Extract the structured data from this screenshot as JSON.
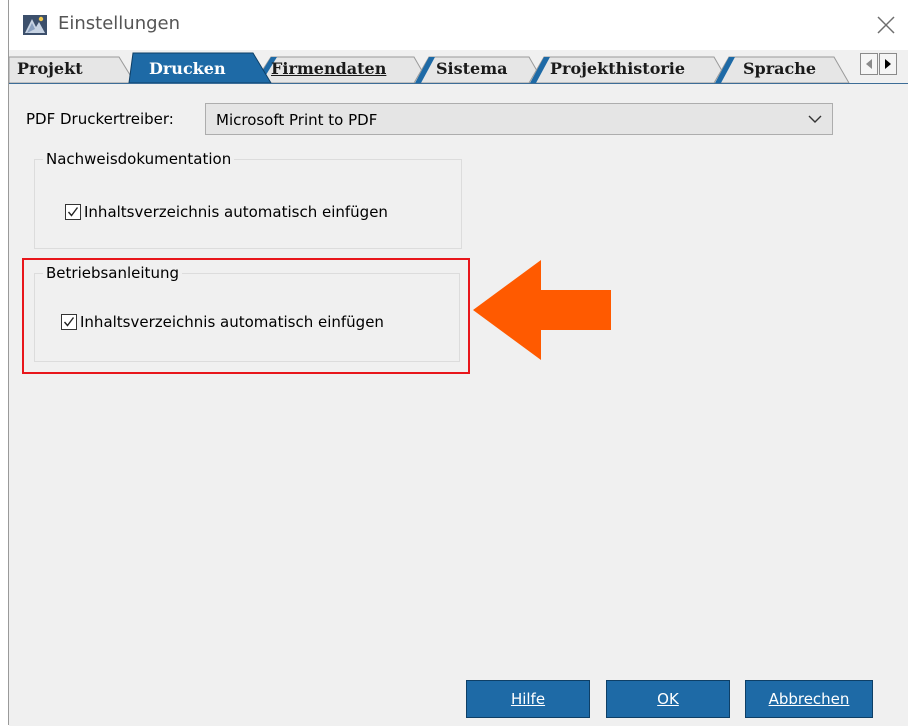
{
  "window": {
    "title": "Einstellungen",
    "close_glyph": "✕",
    "icon": "app-logo-icon"
  },
  "tabs": [
    {
      "label": "Projekt",
      "active": false
    },
    {
      "label": "Drucken",
      "active": true
    },
    {
      "label": "Firmendaten",
      "active": false
    },
    {
      "label": "Sistema",
      "active": false
    },
    {
      "label": "Projekthistorie",
      "active": false
    },
    {
      "label": "Sprache",
      "active": false
    }
  ],
  "tab_scroll": {
    "left_icon": "triangle-left-icon",
    "right_icon": "triangle-right-icon"
  },
  "pdf_driver": {
    "label": "PDF Druckertreiber:",
    "value": "Microsoft Print to PDF"
  },
  "groups": {
    "nachweis": {
      "legend": "Nachweisdokumentation",
      "checkbox_label": "Inhaltsverzeichnis automatisch einfügen",
      "checked": true
    },
    "betrieb": {
      "legend": "Betriebsanleitung",
      "checkbox_label": "Inhaltsverzeichnis automatisch einfügen",
      "checked": true
    }
  },
  "buttons": {
    "help": "Hilfe",
    "ok": "OK",
    "cancel": "Abbrechen"
  },
  "colors": {
    "active_tab": "#1e6aa6",
    "inactive_tab": "#e6e6e6",
    "tab_accent": "#1e6aa6",
    "button_bg": "#1e6aa6",
    "highlight_border": "#e8161b",
    "arrow": "#ff5a00"
  }
}
